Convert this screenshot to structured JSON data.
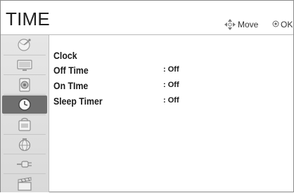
{
  "header": {
    "title": "TIME",
    "hints": {
      "move_label": "Move",
      "ok_label": "OK"
    }
  },
  "sidebar": {
    "items": [
      {
        "name": "satellite-dish-icon",
        "active": false
      },
      {
        "name": "tv-screen-icon",
        "active": false
      },
      {
        "name": "speaker-icon",
        "active": false
      },
      {
        "name": "clock-icon",
        "active": true
      },
      {
        "name": "lock-icon",
        "active": false
      },
      {
        "name": "globe-icon",
        "active": false
      },
      {
        "name": "plug-cable-icon",
        "active": false
      },
      {
        "name": "clapperboard-icon",
        "active": false
      }
    ]
  },
  "menu": {
    "items": [
      {
        "label": "Clock",
        "value": ""
      },
      {
        "label": "Off Time",
        "value": ": Off"
      },
      {
        "label": "On TIme",
        "value": ": Off"
      },
      {
        "label": "Sleep Timer",
        "value": ": Off"
      }
    ]
  },
  "colors": {
    "active_tab": "#6f6f6f",
    "sidebar_bg": "#e0e0e0"
  }
}
